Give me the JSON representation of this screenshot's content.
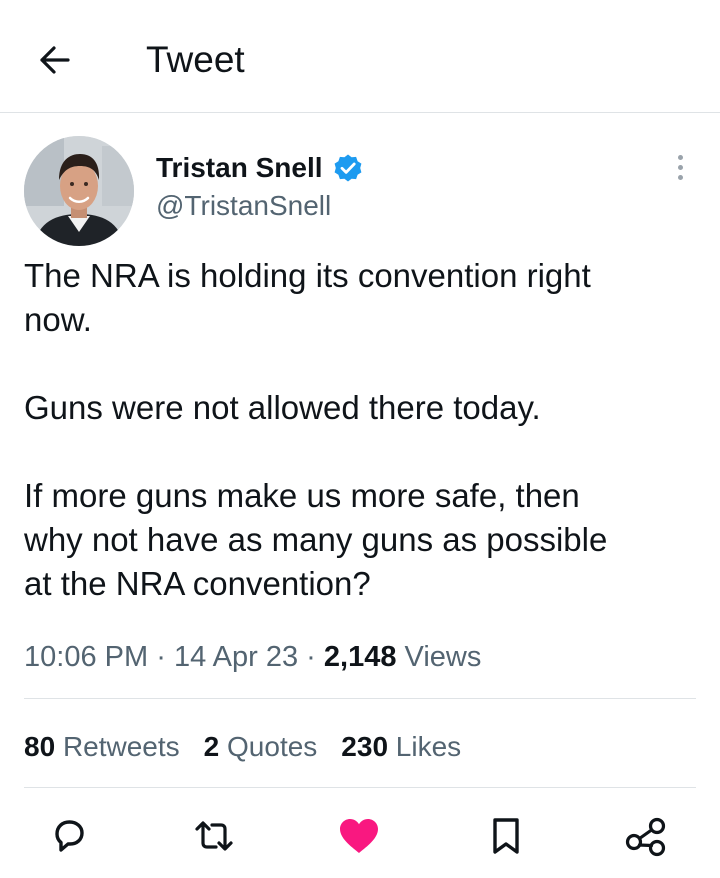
{
  "header": {
    "title": "Tweet",
    "back_icon": "arrow-left-icon"
  },
  "author": {
    "name": "Tristan Snell",
    "handle": "@TristanSnell",
    "verified": true,
    "verified_color": "#1d9bf0"
  },
  "tweet": {
    "paragraphs": [
      "The NRA is holding its convention right\nnow.",
      "Guns were not allowed there today.",
      "If more guns make us more safe, then\nwhy not have as many guns as possible\nat the NRA convention?"
    ]
  },
  "meta": {
    "time": "10:06 PM",
    "separator": "·",
    "date": "14 Apr 23",
    "views_count": "2,148",
    "views_label": "Views"
  },
  "stats": {
    "retweets": {
      "count": "80",
      "label": "Retweets"
    },
    "quotes": {
      "count": "2",
      "label": "Quotes"
    },
    "likes": {
      "count": "230",
      "label": "Likes"
    }
  },
  "actions": {
    "reply_icon": "reply-icon",
    "retweet_icon": "retweet-icon",
    "like_icon": "heart-icon",
    "like_color": "#f91880",
    "liked": true,
    "bookmark_icon": "bookmark-icon",
    "share_icon": "share-icon"
  },
  "colors": {
    "text": "#0f1419",
    "secondary": "#536471",
    "border": "#dfe3e6"
  }
}
